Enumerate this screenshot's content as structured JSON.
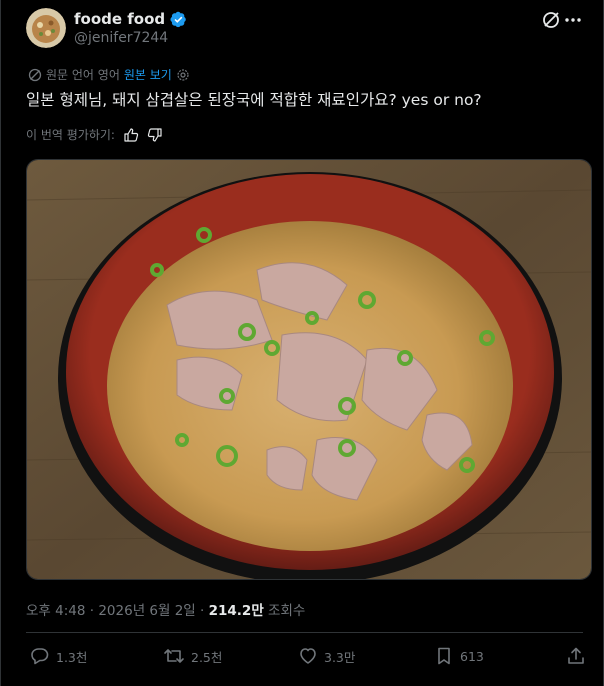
{
  "user": {
    "display_name": "foode food",
    "handle": "@jenifer7244",
    "verified": true,
    "avatar_icon": "food-avatar-icon"
  },
  "translation": {
    "source_label": "원문 언어 영어",
    "view_original_label": "원본 보기",
    "rate_label": "이 번역 평가하기:"
  },
  "tweet": {
    "text": "일본 형제님, 돼지 삼겹살은 된장국에 적합한 재료인가요? yes or no?"
  },
  "media": {
    "alt_icon": "miso-soup-photo"
  },
  "meta": {
    "time": "오후 4:48",
    "separator": "·",
    "date": "2026년 6월 2일",
    "views_count": "214.2만",
    "views_label": "조회수"
  },
  "actions": {
    "reply_count": "1.3천",
    "repost_count": "2.5천",
    "like_count": "3.3만",
    "bookmark_count": "613"
  },
  "colors": {
    "accent": "#1d9bf0",
    "muted": "#71767b",
    "text": "#e7e9ea",
    "background": "#000000"
  }
}
